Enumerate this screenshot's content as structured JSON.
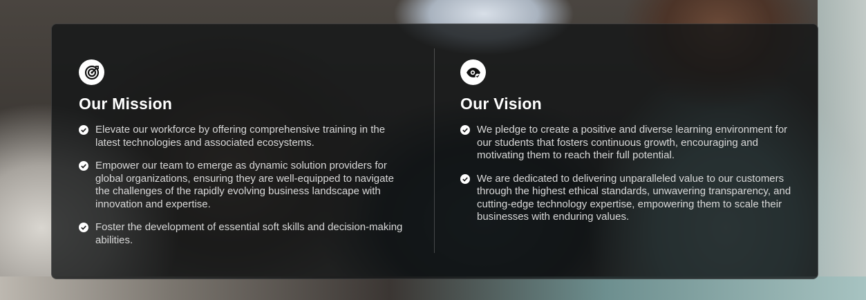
{
  "mission": {
    "title": "Our Mission",
    "icon": "target-icon",
    "items": [
      "Elevate our workforce by offering comprehensive training in the latest technologies and associated ecosystems.",
      "Empower our team to emerge as dynamic solution providers for global organizations, ensuring they are well-equipped to navigate the challenges of the rapidly evolving business landscape with innovation and expertise.",
      "Foster the development of essential soft skills and decision-making abilities."
    ]
  },
  "vision": {
    "title": "Our Vision",
    "icon": "eye-icon",
    "items": [
      "We pledge to create a positive and diverse learning environment for our students that fosters continuous growth, encouraging and motivating them to reach their full potential.",
      "We are dedicated to delivering unparalleled value to our customers through the highest ethical standards, unwavering transparency, and cutting-edge technology expertise, empowering them to scale their businesses with enduring values."
    ]
  },
  "colors": {
    "panel": "#121416",
    "heading": "#ffffff",
    "body_text": "#d9d9d9"
  }
}
